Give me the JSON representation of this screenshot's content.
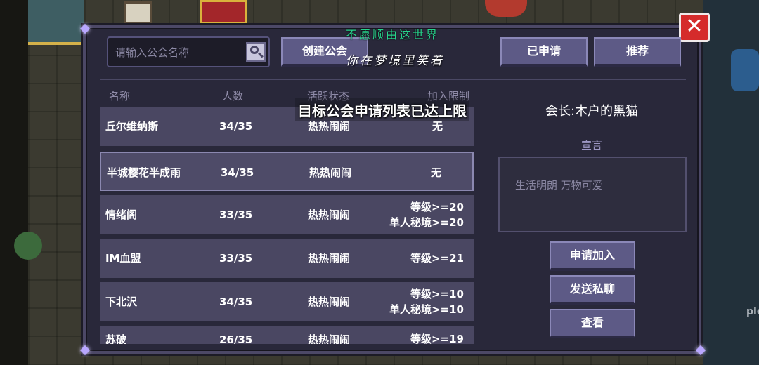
{
  "search": {
    "placeholder": "请输入公会名称"
  },
  "buttons": {
    "create": "创建公会",
    "applied": "已申请",
    "recommend": "推荐",
    "close": "✕",
    "join": "申请加入",
    "chat": "发送私聊",
    "view": "查看"
  },
  "overlay": {
    "line1": "不愿顺由这世界",
    "line2": "你在梦境里笑着"
  },
  "table": {
    "headers": {
      "name": "名称",
      "count": "人数",
      "status": "活跃状态",
      "limit": "加入限制"
    },
    "rows": [
      {
        "name": "丘尔维纳斯",
        "count": "34/35",
        "status": "热热闹闹",
        "limit1": "无",
        "limit2": ""
      },
      {
        "name": "半城樱花半成雨",
        "count": "34/35",
        "status": "热热闹闹",
        "limit1": "无",
        "limit2": ""
      },
      {
        "name": "情绪阁",
        "count": "33/35",
        "status": "热热闹闹",
        "limit1": "等级>=20",
        "limit2": "单人秘境>=20"
      },
      {
        "name": "IM血盟",
        "count": "33/35",
        "status": "热热闹闹",
        "limit1": "等级>=21",
        "limit2": ""
      },
      {
        "name": "下北沢",
        "count": "34/35",
        "status": "热热闹闹",
        "limit1": "等级>=10",
        "limit2": "单人秘境>=10"
      },
      {
        "name": "苏破",
        "count": "26/35",
        "status": "热热闹闹",
        "limit1": "等级>=19",
        "limit2": ""
      }
    ]
  },
  "toast": "目标公会申请列表已达上限",
  "detail": {
    "leader": "会长:木户的黑猫",
    "declaration_label": "宣言",
    "declaration": "生活明朗 万物可爱"
  },
  "background": {
    "corner_text": "ple"
  }
}
